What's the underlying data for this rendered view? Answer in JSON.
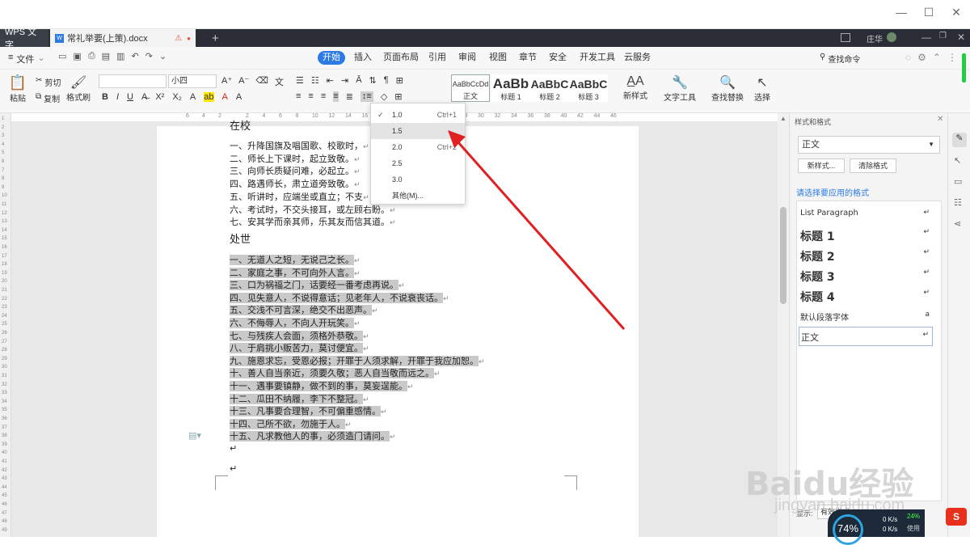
{
  "title_bar": {
    "min": "—",
    "max": "☐",
    "close": "✕"
  },
  "tabs": {
    "app": "WPS 文字",
    "doc": "常礼举要(上策).docx",
    "new": "+",
    "user": "庄华"
  },
  "menu": {
    "file": "文件",
    "items": [
      "开始",
      "插入",
      "页面布局",
      "引用",
      "审阅",
      "视图",
      "章节",
      "安全",
      "开发工具",
      "云服务"
    ],
    "search": "查找命令"
  },
  "ribbon": {
    "paste": "粘贴",
    "cut": "剪切",
    "copy": "复制",
    "format_painter": "格式刷",
    "font_name": "",
    "font_size": "小四",
    "styles": [
      {
        "preview": "AaBbCcDd",
        "label": "正文"
      },
      {
        "preview": "AaBb",
        "label": "标题 1"
      },
      {
        "preview": "AaBbC",
        "label": "标题 2"
      },
      {
        "preview": "AaBbC",
        "label": "标题 3"
      }
    ],
    "new_style": "新样式",
    "text_tools": "文字工具",
    "find_replace": "查找替换",
    "select": "选择"
  },
  "ruler": {
    "left": [
      "6",
      "4",
      "2"
    ],
    "right": [
      "2",
      "4",
      "6",
      "8",
      "10",
      "12",
      "14",
      "16",
      "18",
      "20",
      "22",
      "24",
      "26",
      "28",
      "30",
      "32",
      "34",
      "36",
      "38",
      "40",
      "42",
      "44",
      "46"
    ]
  },
  "vruler": [
    "1",
    "2",
    "3",
    "4",
    "5",
    "6",
    "7",
    "8",
    "9",
    "10",
    "11",
    "12",
    "13",
    "14",
    "15",
    "16",
    "17",
    "18",
    "19",
    "20",
    "21",
    "22",
    "23",
    "24",
    "25",
    "26",
    "27",
    "28",
    "29",
    "30",
    "31",
    "32",
    "33",
    "34",
    "35",
    "36",
    "37",
    "38",
    "39",
    "40",
    "41",
    "42",
    "43",
    "44",
    "45",
    "46",
    "47",
    "48",
    "49"
  ],
  "document": {
    "heading1": "在校",
    "section1": [
      "一、升降国旗及唱国歌、校歌时，",
      "二、师长上下课时，起立致敬。",
      "三、向师长质疑问难，必起立。",
      "四、路遇师长，肃立道旁致敬。",
      "五、听讲时，应端坐或直立；不支",
      "六、考试时，不交头接耳，或左顾右盼。",
      "七、安其学而亲其师，乐其友而信其道。"
    ],
    "heading2": "处世",
    "section2": [
      "一、无道人之短，无说己之长。",
      "二、家庭之事，不可向外人言。",
      "三、口为祸福之门，话要经一番考虑再说。",
      "四、见失意人，不说得意话；见老年人，不说衰丧话。",
      "五、交浅不可言深，绝交不出恶声。",
      "六、不侮辱人，不向人开玩笑。",
      "七、与残疾人会面，须格外恭敬。",
      "八、于肩挑小贩苦力，莫讨便宜。",
      "九、施恩求忘，受恩必报；开罪于人须求解，开罪于我应加恕。",
      "十、善人自当亲近，须要久敬；恶人自当敬而远之。",
      "十一、遇事要镇静，做不到的事，莫妄逞能。",
      "十二、瓜田不纳履，李下不整冠。",
      "十三、凡事要合理智，不可偏重感情。",
      "十四、己所不欲，勿施于人。",
      "十五、凡求教他人的事，必须造门请问。"
    ],
    "para_mark": "↵"
  },
  "line_spacing_menu": {
    "items": [
      {
        "label": "1.0",
        "shortcut": "Ctrl+1",
        "checked": true
      },
      {
        "label": "1.5",
        "shortcut": "",
        "checked": false
      },
      {
        "label": "2.0",
        "shortcut": "Ctrl+2",
        "checked": false
      },
      {
        "label": "2.5",
        "shortcut": "",
        "checked": false
      },
      {
        "label": "3.0",
        "shortcut": "",
        "checked": false
      },
      {
        "label": "其他(M)...",
        "shortcut": "",
        "checked": false
      }
    ]
  },
  "task_pane": {
    "title": "样式和格式",
    "current": "正文",
    "new_btn": "新样式...",
    "clear_btn": "清除格式",
    "prompt": "请选择要应用的格式",
    "styles": [
      "List Paragraph",
      "标题 1",
      "标题 2",
      "标题 3",
      "标题 4",
      "默认段落字体",
      "正文"
    ],
    "show_label": "显示:",
    "show_value": "有效样式"
  },
  "status": {
    "percent": "74%",
    "up": "0 K/s",
    "down": "0 K/s",
    "cpu": "24%",
    "used": "使用"
  },
  "watermark": {
    "brand": "Baidu经验",
    "url": "jingyan.baidu.com"
  },
  "colors": {
    "accent": "#2c7be5",
    "arrow": "#e02020",
    "tabbar": "#2a2d35"
  }
}
